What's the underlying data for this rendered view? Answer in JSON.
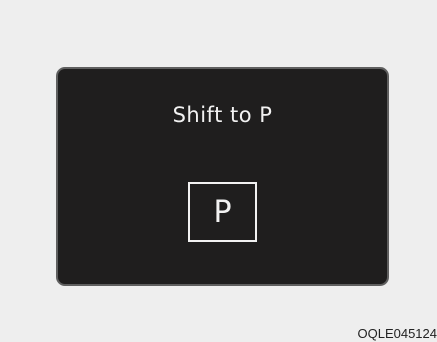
{
  "display": {
    "message": "Shift to P",
    "gear_indicator": "P"
  },
  "caption": "OQLE045124"
}
